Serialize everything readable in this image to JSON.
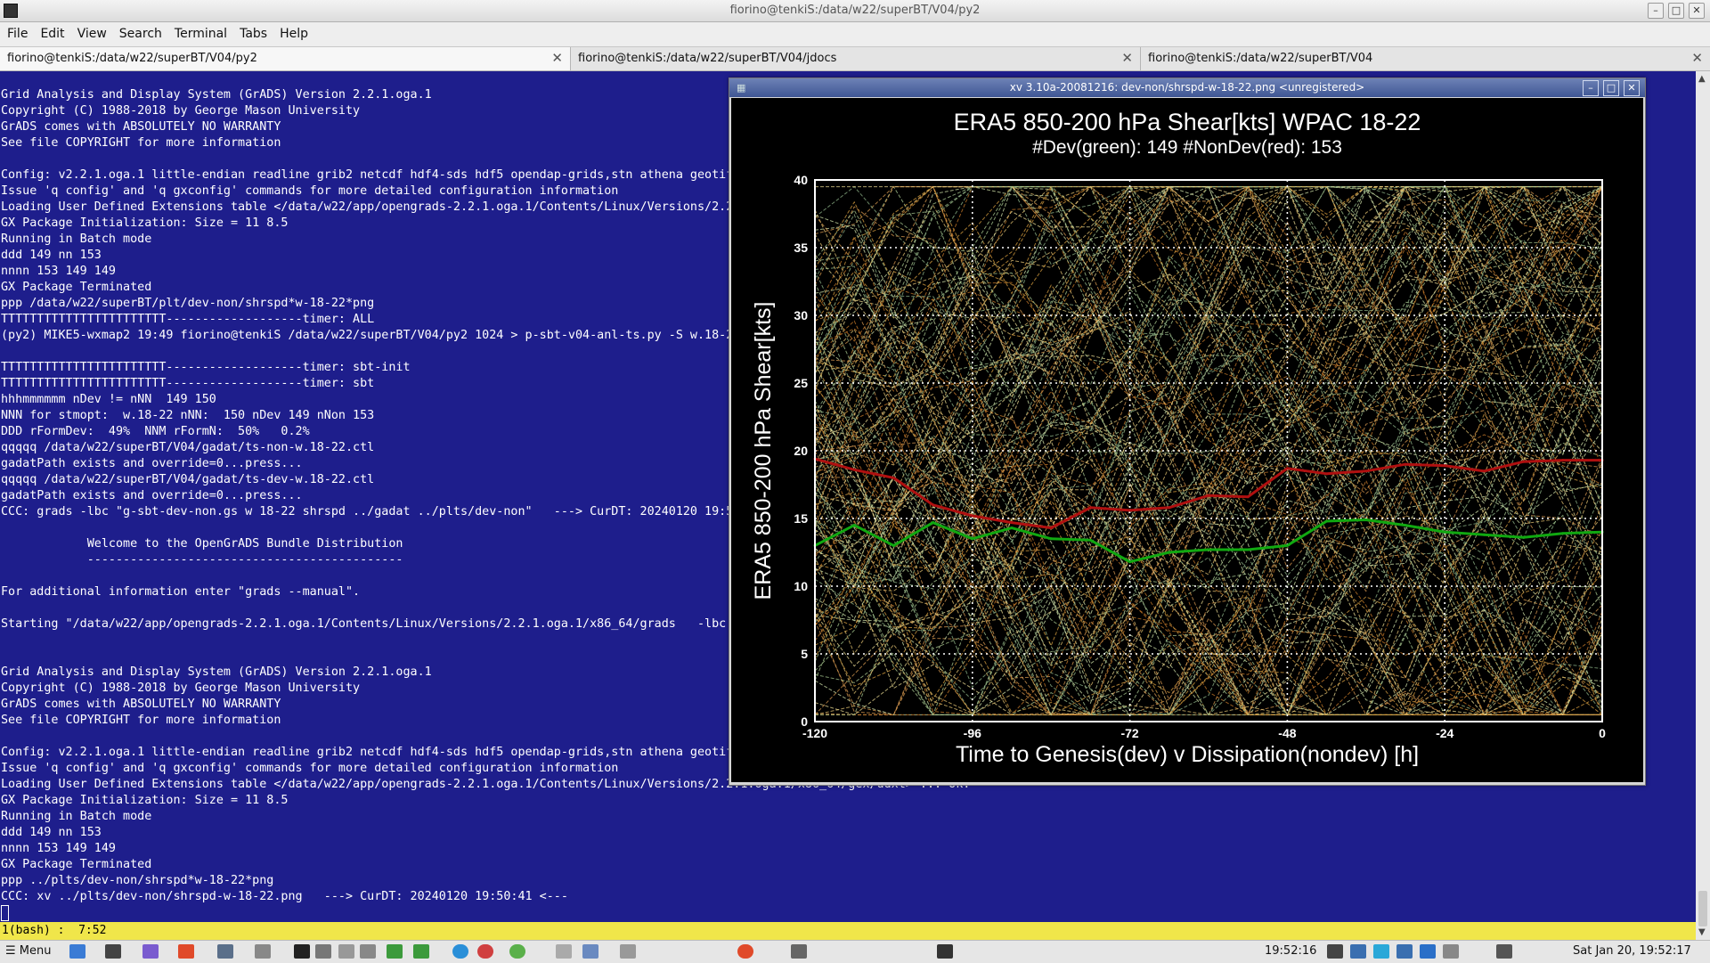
{
  "window": {
    "title": "fiorino@tenkiS:/data/w22/superBT/V04/py2"
  },
  "menu": [
    "File",
    "Edit",
    "View",
    "Search",
    "Terminal",
    "Tabs",
    "Help"
  ],
  "tabs": [
    {
      "label": "fiorino@tenkiS:/data/w22/superBT/V04/py2"
    },
    {
      "label": "fiorino@tenkiS:/data/w22/superBT/V04/jdocs"
    },
    {
      "label": "fiorino@tenkiS:/data/w22/superBT/V04"
    }
  ],
  "terminal": {
    "lines": [
      "Grid Analysis and Display System (GrADS) Version 2.2.1.oga.1",
      "Copyright (C) 1988-2018 by George Mason University",
      "GrADS comes with ABSOLUTELY NO WARRANTY",
      "See file COPYRIGHT for more information",
      "",
      "Config: v2.2.1.oga.1 little-endian readline grib2 netcdf hdf4-sds hdf5 opendap-grids,stn athena geotif",
      "Issue 'q config' and 'q gxconfig' commands for more detailed configuration information",
      "Loading User Defined Extensions table </data/w22/app/opengrads-2.2.1.oga.1/Contents/Linux/Versions/2.2",
      "GX Package Initialization: Size = 11 8.5",
      "Running in Batch mode",
      "ddd 149 nn 153",
      "nnnn 153 149 149",
      "GX Package Terminated",
      "ppp /data/w22/superBT/plt/dev-non/shrspd*w-18-22*png",
      "TTTTTTTTTTTTTTTTTTTTTTT-------------------timer: ALL",
      "(py2) MIKE5-wxmap2 19:49 fiorino@tenkiS /data/w22/superBT/V04/py2 1024 > p-sbt-v04-anl-ts.py -S w.18-2",
      "",
      "TTTTTTTTTTTTTTTTTTTTTTT-------------------timer: sbt-init",
      "TTTTTTTTTTTTTTTTTTTTTTT-------------------timer: sbt",
      "hhhmmmmmm nDev != nNN  149 150",
      "NNN for stmopt:  w.18-22 nNN:  150 nDev 149 nNon 153",
      "DDD rFormDev:  49%  NNM rFormN:  50%   0.2%",
      "qqqqq /data/w22/superBT/V04/gadat/ts-non-w.18-22.ctl",
      "gadatPath exists and override=0...press...",
      "qqqqq /data/w22/superBT/V04/gadat/ts-dev-w.18-22.ctl",
      "gadatPath exists and override=0...press...",
      "CCC: grads -lbc \"g-sbt-dev-non.gs w 18-22 shrspd ../gadat ../plts/dev-non\"   ---> CurDT: 20240120 19:5",
      "",
      "            Welcome to the OpenGrADS Bundle Distribution",
      "            --------------------------------------------",
      "",
      "For additional information enter \"grads --manual\".",
      "",
      "Starting \"/data/w22/app/opengrads-2.2.1.oga.1/Contents/Linux/Versions/2.2.1.oga.1/x86_64/grads   -lbc",
      "",
      "",
      "Grid Analysis and Display System (GrADS) Version 2.2.1.oga.1",
      "Copyright (C) 1988-2018 by George Mason University",
      "GrADS comes with ABSOLUTELY NO WARRANTY",
      "See file COPYRIGHT for more information",
      "",
      "Config: v2.2.1.oga.1 little-endian readline grib2 netcdf hdf4-sds hdf5 opendap-grids,stn athena geotif",
      "Issue 'q config' and 'q gxconfig' commands for more detailed configuration information",
      "Loading User Defined Extensions table </data/w22/app/opengrads-2.2.1.oga.1/Contents/Linux/Versions/2.2.1.oga.1/x86_64/gex/udxt> ... ok.",
      "GX Package Initialization: Size = 11 8.5",
      "Running in Batch mode",
      "ddd 149 nn 153",
      "nnnn 153 149 149",
      "GX Package Terminated",
      "ppp ../plts/dev-non/shrspd*w-18-22*png",
      "CCC: xv ../plts/dev-non/shrspd-w-18-22.png   ---> CurDT: 20240120 19:50:41 <---"
    ]
  },
  "statusbar": {
    "text": "1(bash) :  7:52"
  },
  "xv": {
    "title": "xv 3.10a-20081216: dev-non/shrspd-w-18-22.png <unregistered>"
  },
  "chart_data": {
    "type": "line",
    "title": "ERA5 850-200 hPa Shear[kts] WPAC 18-22",
    "subtitle": "#Dev(green): 149 #NonDev(red): 153",
    "xlabel": "Time to Genesis(dev) v Dissipation(nondev) [h]",
    "ylabel": "ERA5 850-200 hPa Shear[kts]",
    "xlim": [
      -120,
      0
    ],
    "ylim": [
      0,
      40
    ],
    "x_ticks": [
      "-120",
      "-96",
      "-72",
      "-48",
      "-24",
      "0"
    ],
    "y_ticks": [
      "0",
      "5",
      "10",
      "15",
      "20",
      "25",
      "30",
      "35",
      "40"
    ],
    "grid": true,
    "colors": {
      "dev_mean": "#11a811",
      "nondev_mean": "#b01010",
      "dev_members": "#b8d8a0",
      "nondev_members": "#d08c3c"
    },
    "series": [
      {
        "name": "#NonDev(red)",
        "x": [
          -120,
          -114,
          -108,
          -102,
          -96,
          -90,
          -84,
          -78,
          -72,
          -66,
          -60,
          -54,
          -48,
          -42,
          -36,
          -30,
          -24,
          -18,
          -12,
          -6,
          0
        ],
        "values": [
          19.4,
          18.6,
          18.0,
          16.0,
          15.2,
          14.7,
          14.3,
          15.8,
          15.6,
          15.8,
          16.7,
          16.6,
          18.7,
          18.3,
          18.5,
          19.0,
          18.9,
          18.5,
          19.2,
          19.3,
          19.3
        ]
      },
      {
        "name": "#Dev(green)",
        "x": [
          -120,
          -114,
          -108,
          -102,
          -96,
          -90,
          -84,
          -78,
          -72,
          -66,
          -60,
          -54,
          -48,
          -42,
          -36,
          -30,
          -24,
          -18,
          -12,
          -6,
          0
        ],
        "values": [
          13.0,
          14.5,
          13.0,
          14.7,
          13.5,
          14.3,
          13.5,
          13.4,
          11.8,
          12.5,
          12.7,
          12.7,
          13.0,
          14.8,
          14.9,
          14.5,
          14.0,
          13.8,
          13.6,
          13.9,
          14.0
        ]
      }
    ]
  }
}
